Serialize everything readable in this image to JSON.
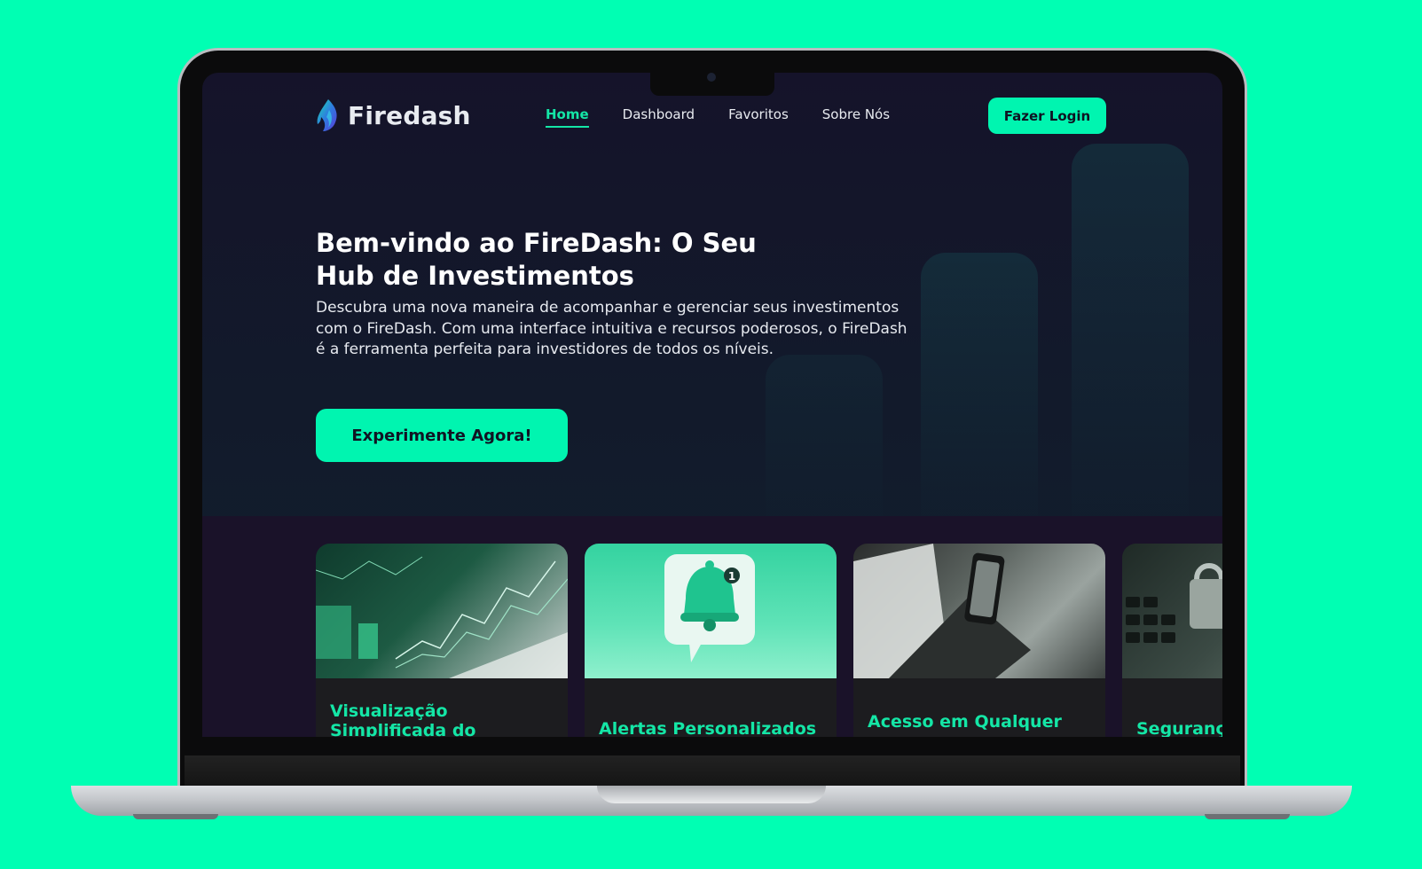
{
  "brand": {
    "name": "Firedash",
    "accent": "#00f5b0",
    "background": "#00ffb3"
  },
  "nav": {
    "items": [
      {
        "label": "Home",
        "active": true
      },
      {
        "label": "Dashboard",
        "active": false
      },
      {
        "label": "Favoritos",
        "active": false
      },
      {
        "label": "Sobre Nós",
        "active": false
      }
    ]
  },
  "header": {
    "login_label": "Fazer Login"
  },
  "hero": {
    "title": "Bem-vindo ao FireDash: O Seu Hub de Investimentos",
    "description": "Descubra uma nova maneira de acompanhar e gerenciar seus investimentos com o FireDash. Com uma interface intuitiva e recursos poderosos, o FireDash é a ferramenta perfeita para investidores de todos os níveis.",
    "cta_label": "Experimente Agora!"
  },
  "features": {
    "cards": [
      {
        "title": "Visualização Simplificada do Portfólio",
        "image": "chart-screen"
      },
      {
        "title": "Alertas Personalizados",
        "image": "notification-bell"
      },
      {
        "title": "Acesso em Qualquer",
        "image": "laptop-and-phone"
      },
      {
        "title": "Segurança",
        "image": "keyboard-padlock"
      }
    ]
  }
}
